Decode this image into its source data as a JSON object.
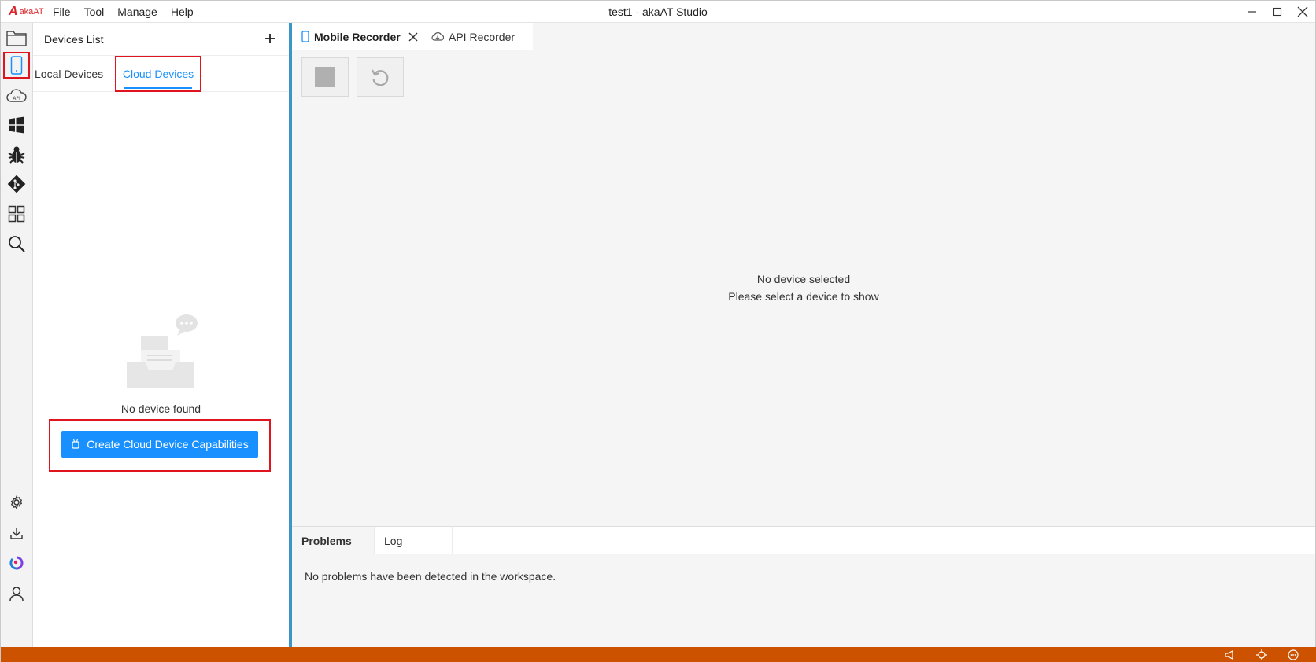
{
  "app": {
    "logo_text": "akaAT",
    "window_title": "test1 - akaAT Studio"
  },
  "menu": {
    "items": [
      "File",
      "Tool",
      "Manage",
      "Help"
    ]
  },
  "activity_bar": {
    "items": [
      {
        "name": "explorer",
        "icon": "folder-icon"
      },
      {
        "name": "mobile",
        "icon": "mobile-phone-icon",
        "selected": true
      },
      {
        "name": "api",
        "icon": "cloud-api-icon"
      },
      {
        "name": "windows",
        "icon": "windows-icon"
      },
      {
        "name": "debug",
        "icon": "bug-icon"
      },
      {
        "name": "git",
        "icon": "git-icon"
      },
      {
        "name": "extensions",
        "icon": "grid-icon"
      },
      {
        "name": "search",
        "icon": "search-icon"
      },
      {
        "name": "settings",
        "icon": "gear-icon"
      },
      {
        "name": "download",
        "icon": "download-icon"
      },
      {
        "name": "brand",
        "icon": "brand-logo-icon"
      },
      {
        "name": "account",
        "icon": "user-icon"
      }
    ]
  },
  "side_panel": {
    "title": "Devices List",
    "tabs": [
      {
        "label": "Local Devices",
        "active": false
      },
      {
        "label": "Cloud Devices",
        "active": true
      }
    ],
    "empty_text": "No device found",
    "create_button_label": "Create Cloud Device Capabilities"
  },
  "editor": {
    "tabs": [
      {
        "label": "Mobile Recorder",
        "active": true,
        "icon": "mobile-phone-icon"
      },
      {
        "label": "API Recorder",
        "active": false,
        "icon": "cloud-api-icon"
      }
    ],
    "canvas_message_line1": "No device selected",
    "canvas_message_line2": "Please select a device to show"
  },
  "bottom_panel": {
    "tabs": [
      {
        "label": "Problems",
        "active": true
      },
      {
        "label": "Log",
        "active": false
      }
    ],
    "problems_message": "No problems have been detected in the workspace."
  },
  "colors": {
    "accent": "#1890ff",
    "status_bar": "#cc5200",
    "highlight_box": "#e0141e",
    "splitter": "#3c95c9"
  }
}
